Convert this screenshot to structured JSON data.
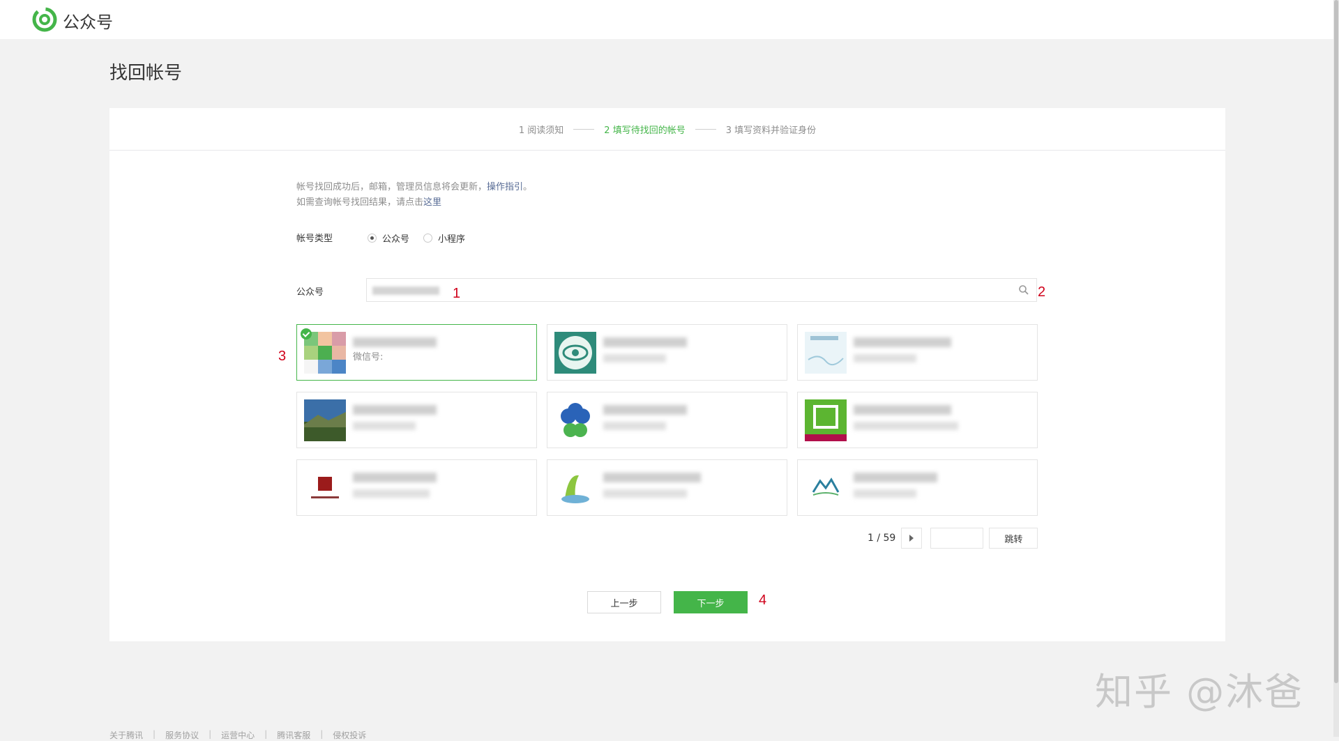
{
  "header": {
    "logo_text": "公众号",
    "brand_color": "#44b549"
  },
  "page": {
    "title": "找回帐号"
  },
  "steps": [
    {
      "label": "1 阅读须知",
      "active": false
    },
    {
      "label": "2 填写待找回的帐号",
      "active": true
    },
    {
      "label": "3 填写资料并验证身份",
      "active": false
    }
  ],
  "notice": {
    "line1_text": "帐号找回成功后，邮箱，管理员信息将会更新，",
    "line1_link": "操作指引",
    "line1_end": "。",
    "line2_text": "如需查询帐号找回结果，请点击",
    "line2_link": "这里"
  },
  "account_type": {
    "label": "帐号类型",
    "options": [
      "公众号",
      "小程序"
    ],
    "selected": "公众号"
  },
  "search": {
    "label": "公众号",
    "icon": "search-icon"
  },
  "annotations": {
    "a1": "1",
    "a2": "2",
    "a3": "3",
    "a4": "4"
  },
  "results": {
    "selected_wechat_label": "微信号:"
  },
  "pagination": {
    "current": "1 / 59",
    "jump_label": "跳转"
  },
  "actions": {
    "prev": "上一步",
    "next": "下一步"
  },
  "watermark": "知乎 @沐爸",
  "footer": [
    "关于腾讯",
    "服务协议",
    "运营中心",
    "腾讯客服",
    "侵权投诉"
  ]
}
